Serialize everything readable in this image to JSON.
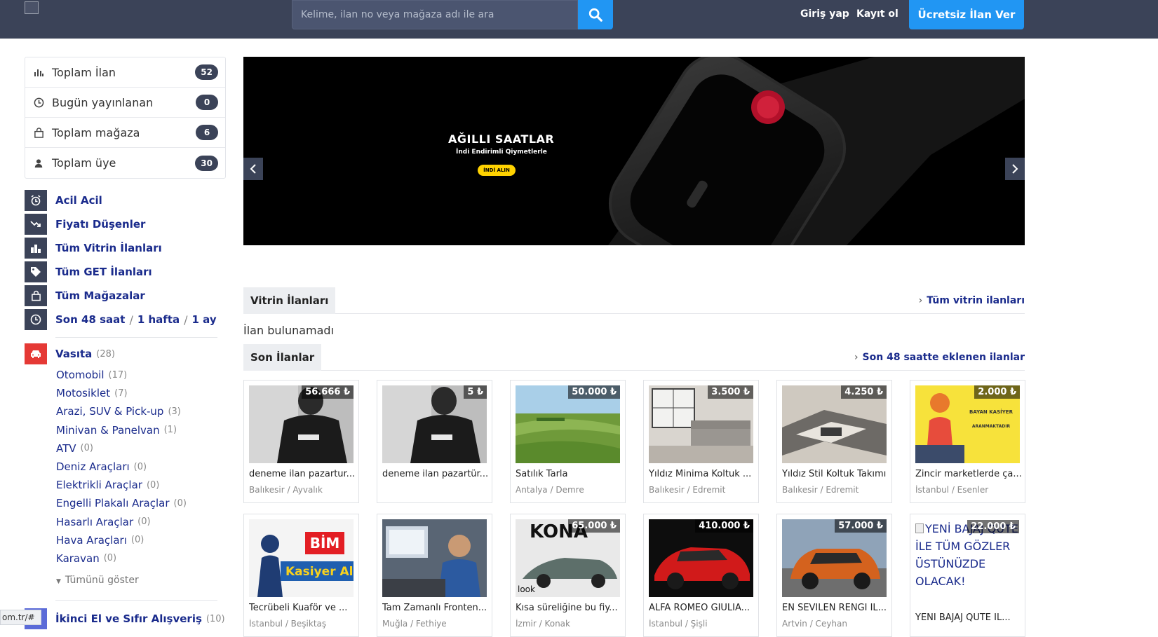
{
  "header": {
    "search_placeholder": "Kelime, ilan no veya mağaza adı ile ara",
    "login": "Giriş yap",
    "register": "Kayıt ol",
    "cta": "Ücretsiz İlan Ver"
  },
  "stats": [
    {
      "label": "Toplam İlan",
      "count": "52"
    },
    {
      "label": "Bugün yayınlanan",
      "count": "0"
    },
    {
      "label": "Toplam mağaza",
      "count": "6"
    },
    {
      "label": "Toplam üye",
      "count": "30"
    }
  ],
  "quick_links": [
    {
      "label": "Acil Acil"
    },
    {
      "label": "Fiyatı Düşenler"
    },
    {
      "label": "Tüm Vitrin İlanları"
    },
    {
      "label": "Tüm GET İlanları"
    },
    {
      "label": "Tüm Mağazalar"
    }
  ],
  "time_links": {
    "a": "Son 48 saat",
    "b": "1 hafta",
    "c": "1 ay",
    "sep": "/"
  },
  "category": {
    "title": "Vasıta",
    "count": "(28)",
    "items": [
      {
        "label": "Otomobil",
        "count": "(17)"
      },
      {
        "label": "Motosiklet",
        "count": "(7)"
      },
      {
        "label": "Arazi, SUV & Pick-up",
        "count": "(3)"
      },
      {
        "label": "Minivan & Panelvan",
        "count": "(1)"
      },
      {
        "label": "ATV",
        "count": "(0)"
      },
      {
        "label": "Deniz Araçları",
        "count": "(0)"
      },
      {
        "label": "Elektrikli Araçlar",
        "count": "(0)"
      },
      {
        "label": "Engelli Plakalı Araçlar",
        "count": "(0)"
      },
      {
        "label": "Hasarlı Araçlar",
        "count": "(0)"
      },
      {
        "label": "Hava Araçları",
        "count": "(0)"
      },
      {
        "label": "Karavan",
        "count": "(0)"
      }
    ],
    "show_all": "Tümünü göster"
  },
  "category2": {
    "title": "İkinci El ve Sıfır Alışveriş",
    "count": "(10)"
  },
  "url_tip": "om.tr/#",
  "banner": {
    "title": "AĞILLI SAATLAR",
    "subtitle": "İndi Endirimli Qiymetlerle",
    "button": "İNDİ ALIN"
  },
  "vitrin": {
    "tab": "Vitrin İlanları",
    "link": "Tüm vitrin ilanları",
    "empty": "İlan bulunamadı"
  },
  "son": {
    "tab": "Son İlanlar",
    "link": "Son 48 saatte eklenen ilanlar"
  },
  "listings": [
    {
      "price": "56.666 ₺",
      "title": "deneme ilan pazartur...",
      "location": "Balıkesir / Ayvalık"
    },
    {
      "price": "5 ₺",
      "title": "deneme ilan pazartür...",
      "location": ""
    },
    {
      "price": "50.000 ₺",
      "title": "Satılık Tarla",
      "location": "Antalya / Demre"
    },
    {
      "price": "3.500 ₺",
      "title": "Yıldız Minima Koltuk ...",
      "location": "Balıkesir / Edremit"
    },
    {
      "price": "4.250 ₺",
      "title": "Yıldız Stil Koltuk Takımı",
      "location": "Balıkesir / Edremit"
    },
    {
      "price": "2.000 ₺",
      "title": "Zincir marketlerde ça...",
      "location": "İstanbul / Esenler"
    },
    {
      "price": "",
      "title": "Tecrübeli Kuaför ve ...",
      "location": "İstanbul / Beşiktaş"
    },
    {
      "price": "",
      "title": "Tam Zamanlı Fronten...",
      "location": "Muğla / Fethiye"
    },
    {
      "price": "65.000 ₺",
      "title": "Kısa süreliğine bu fiy...",
      "location": "İzmir / Konak"
    },
    {
      "price": "410.000 ₺",
      "title": "ALFA ROMEO GIULIA...",
      "location": "İstanbul / Şişli"
    },
    {
      "price": "57.000 ₺",
      "title": "EN SEVİLEN RENGİ İL...",
      "location": "Artvin / Ceyhan"
    },
    {
      "price": "22.000 ₺",
      "title": "YENİ BAJAJ QUTE İL...",
      "location": ""
    }
  ],
  "broken_img_alt": "YENİ BAJAJ QUTE İLE TÜM GÖZLER ÜSTÜNÜZDE OLACAK!",
  "thumb_texts": {
    "bim": "BİM",
    "kasiyer": "Kasiyer Al",
    "kona": "KONA",
    "look": "look",
    "bayan": "BAYAN KASİYER",
    "aranmaktadir": "ARANMAKTADIR"
  }
}
